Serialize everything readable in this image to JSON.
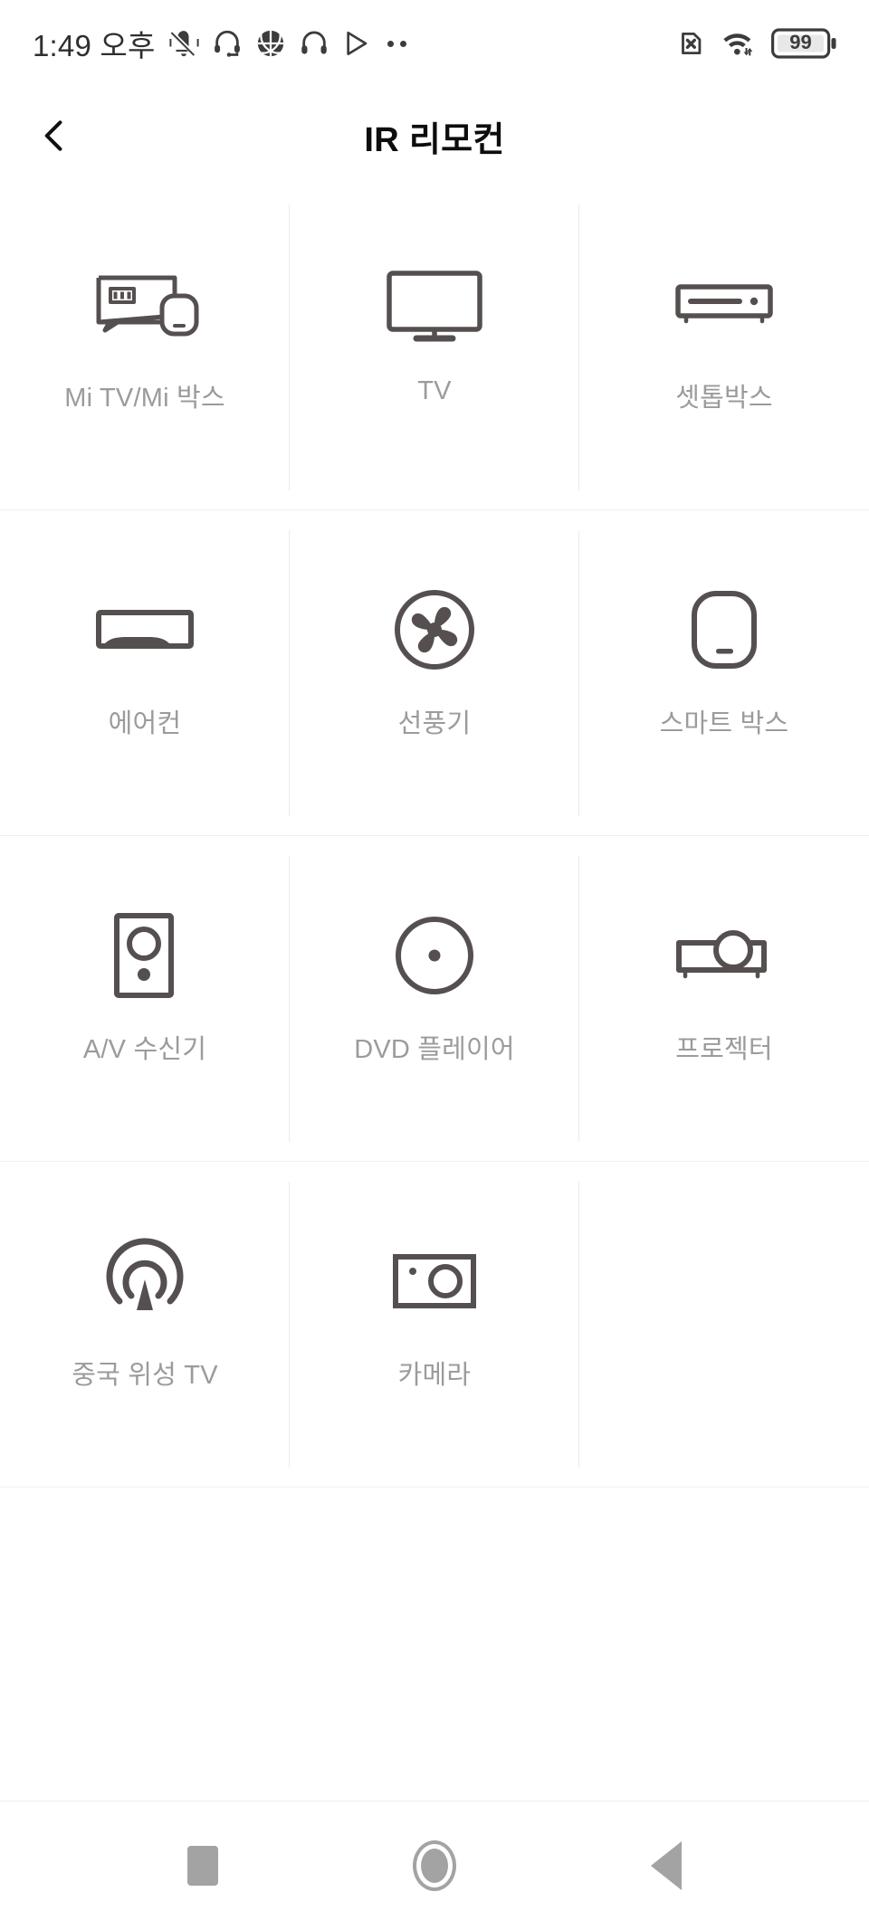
{
  "status_bar": {
    "time": "1:49 오후",
    "left_icons": [
      {
        "name": "mute-vibrate-icon"
      },
      {
        "name": "headset-mic-icon"
      },
      {
        "name": "basketball-icon"
      },
      {
        "name": "headphones-icon"
      },
      {
        "name": "play-store-icon"
      },
      {
        "name": "more-dots-icon"
      }
    ],
    "right_icons": [
      {
        "name": "no-sim-icon"
      },
      {
        "name": "wifi-icon"
      }
    ],
    "battery_level": "99",
    "colors": {
      "icon": "#3c3c3c",
      "text": "#2f2f2f"
    }
  },
  "header": {
    "back_label": "back",
    "title": "IR 리모컨"
  },
  "grid": {
    "items": [
      {
        "label": "Mi TV/Mi 박스",
        "icon": "mi-tv-box-icon"
      },
      {
        "label": "TV",
        "icon": "tv-icon"
      },
      {
        "label": "셋톱박스",
        "icon": "set-top-box-icon"
      },
      {
        "label": "에어컨",
        "icon": "air-conditioner-icon"
      },
      {
        "label": "선풍기",
        "icon": "fan-icon"
      },
      {
        "label": "스마트 박스",
        "icon": "smart-box-icon"
      },
      {
        "label": "A/V 수신기",
        "icon": "av-receiver-icon"
      },
      {
        "label": "DVD 플레이어",
        "icon": "dvd-player-icon"
      },
      {
        "label": "프로젝터",
        "icon": "projector-icon"
      },
      {
        "label": "중국 위성 TV",
        "icon": "satellite-tv-icon"
      },
      {
        "label": "카메라",
        "icon": "camera-icon"
      }
    ],
    "colors": {
      "icon": "#55504f",
      "label": "#9b9b9b",
      "divider": "#ebebeb"
    }
  },
  "nav_bar": {
    "buttons": [
      {
        "name": "recents-button"
      },
      {
        "name": "home-button"
      },
      {
        "name": "back-button"
      }
    ],
    "color": "#a3a3a3"
  }
}
